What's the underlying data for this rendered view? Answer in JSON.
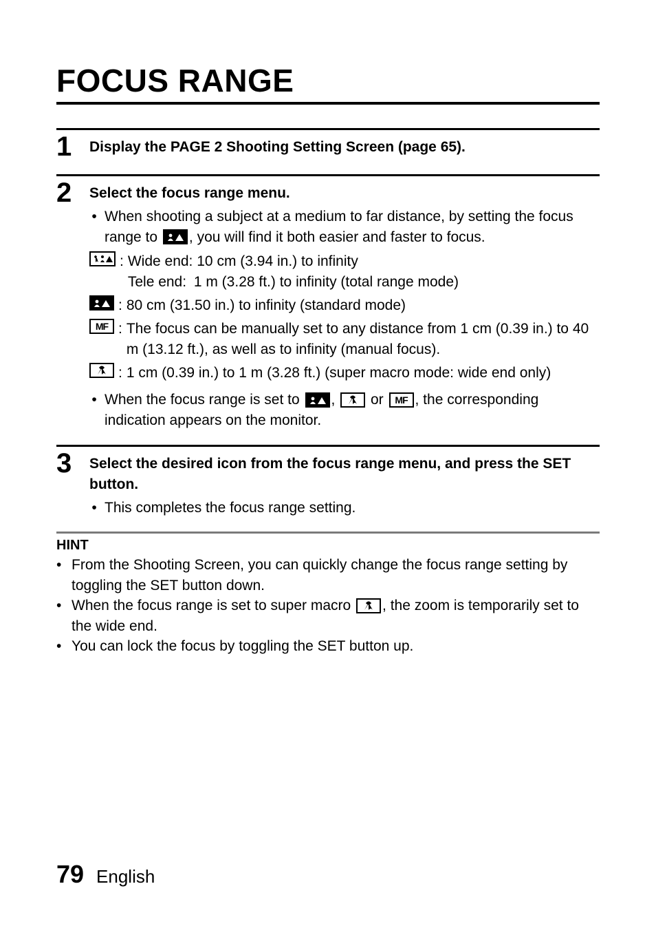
{
  "title": "FOCUS RANGE",
  "steps": [
    {
      "num": "1",
      "head": "Display the PAGE 2 Shooting Setting Screen (page 65)."
    },
    {
      "num": "2",
      "head": "Select the focus range menu.",
      "intro_pre": "When shooting a subject at a medium to far distance, by setting the focus range to ",
      "intro_post": ", you will find it both easier and faster to focus.",
      "modes": {
        "total_wide_label": "Wide end:",
        "total_wide_value": "10 cm (3.94 in.) to infinity",
        "total_tele_label": "Tele end:",
        "total_tele_value": "1 m (3.28 ft.) to infinity (total range mode)",
        "standard": "80 cm (31.50 in.) to infinity (standard mode)",
        "mf": "The focus can be manually set to any distance from 1 cm (0.39 in.) to 40 m (13.12 ft.), as well as to infinity (manual focus).",
        "macro": "1 cm (0.39 in.) to 1 m (3.28 ft.) (super macro mode: wide end only)"
      },
      "note_pre": "When the focus range is set to ",
      "note_mid1": ", ",
      "note_mid2": " or ",
      "note_post": ", the corresponding indication appears on the monitor."
    },
    {
      "num": "3",
      "head": "Select the desired icon from the focus range menu, and press the SET button.",
      "sub": "This completes the focus range setting."
    }
  ],
  "hint": {
    "title": "HINT",
    "items": [
      "From the Shooting Screen, you can quickly change the focus range setting by toggling the SET button down.",
      {
        "pre": "When the focus range is set to super macro ",
        "post": ", the zoom is temporarily set to the wide end."
      },
      "You can lock the focus by toggling the SET button up."
    ]
  },
  "footer": {
    "page": "79",
    "lang": "English"
  },
  "icons": {
    "total": "total-range-icon",
    "standard": "standard-mode-icon",
    "mf": "MF",
    "macro": "super-macro-icon"
  }
}
